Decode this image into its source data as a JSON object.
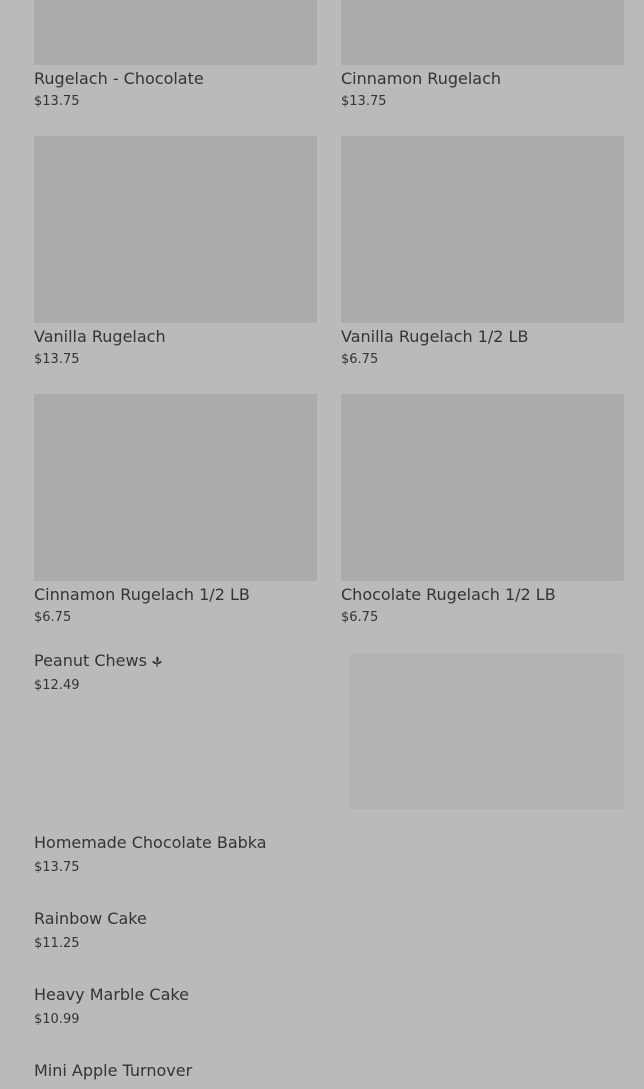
{
  "products_grid": [
    {
      "title": "Rugelach  - Chocolate",
      "price": "$13.75"
    },
    {
      "title": "Cinnamon Rugelach",
      "price": "$13.75"
    },
    {
      "title": "Vanilla Rugelach",
      "price": "$13.75"
    },
    {
      "title": "Vanilla Rugelach 1/2 LB",
      "price": "$6.75"
    },
    {
      "title": "Cinnamon Rugelach 1/2 LB",
      "price": "$6.75"
    },
    {
      "title": "Chocolate Rugelach 1/2 LB",
      "price": "$6.75"
    }
  ],
  "featured": {
    "title": "Peanut Chews",
    "icon": "vegan-leaf-icon",
    "price": "$12.49"
  },
  "list": [
    {
      "title": "Homemade Chocolate Babka",
      "price": "$13.75"
    },
    {
      "title": "Rainbow Cake",
      "price": "$11.25"
    },
    {
      "title": "Heavy Marble Cake",
      "price": "$10.99"
    },
    {
      "title": "Mini Apple Turnover",
      "price": ""
    }
  ],
  "colors": {
    "background": "#bababa",
    "placeholder": "#ababab",
    "text": "#343434"
  }
}
